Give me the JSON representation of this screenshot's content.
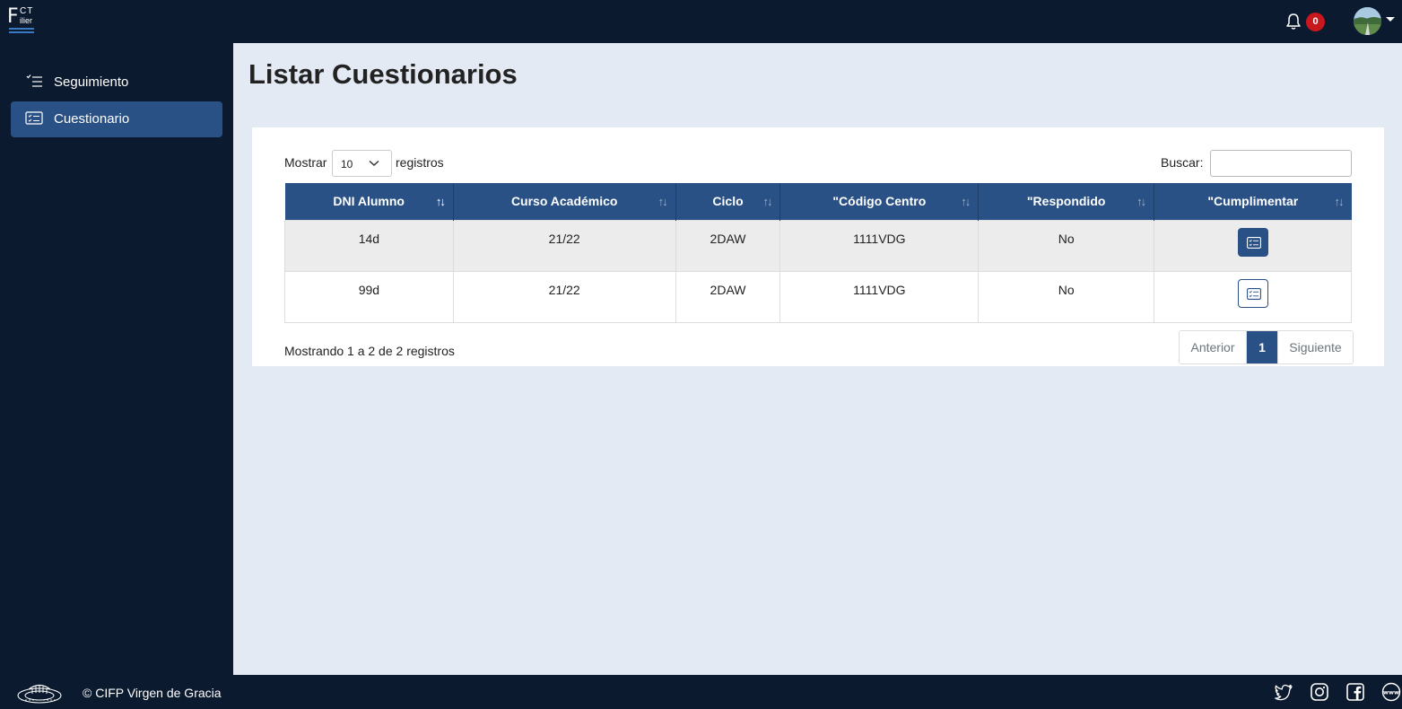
{
  "logo": {
    "big": "F",
    "ct": "CT",
    "filier": "ilier"
  },
  "header": {
    "notifications_count": "0"
  },
  "sidebar": {
    "items": [
      {
        "label": "Seguimiento",
        "icon": "checklist-icon"
      },
      {
        "label": "Cuestionario",
        "icon": "form-card-icon",
        "active": true
      }
    ]
  },
  "main": {
    "title": "Listar Cuestionarios",
    "length": {
      "prefix": "Mostrar",
      "value": "10",
      "suffix": "registros"
    },
    "search": {
      "label": "Buscar:",
      "value": ""
    },
    "table": {
      "columns": [
        "DNI Alumno",
        "Curso Académico",
        "Ciclo",
        "\"Código Centro",
        "\"Respondido",
        "\"Cumplimentar"
      ],
      "rows": [
        {
          "dni": "14d",
          "curso": "21/22",
          "ciclo": "2DAW",
          "centro": "1111VDG",
          "respondido": "No"
        },
        {
          "dni": "99d",
          "curso": "21/22",
          "ciclo": "2DAW",
          "centro": "1111VDG",
          "respondido": "No"
        }
      ]
    },
    "info": "Mostrando 1 a 2 de 2 registros",
    "pagination": {
      "prev": "Anterior",
      "current": "1",
      "next": "Siguiente"
    }
  },
  "footer": {
    "text": "© CIFP Virgen de Gracia",
    "social": [
      "twitter-icon",
      "instagram-icon",
      "facebook-icon",
      "www-icon"
    ]
  },
  "colors": {
    "navy": "#0b1a2e",
    "accent": "#2a5185",
    "badge": "#c8171d",
    "content_bg": "#e4eaf3"
  }
}
